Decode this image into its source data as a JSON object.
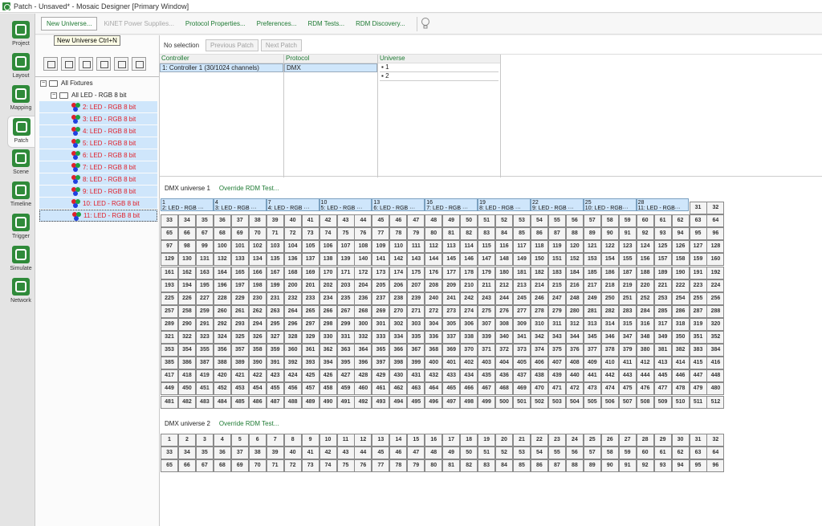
{
  "window": {
    "title": "Patch - Unsaved* - Mosaic Designer [Primary Window]"
  },
  "sidebar": {
    "items": [
      {
        "label": "Project",
        "icon": "project-icon"
      },
      {
        "label": "Layout",
        "icon": "layout-icon"
      },
      {
        "label": "Mapping",
        "icon": "mapping-icon"
      },
      {
        "label": "Patch",
        "icon": "patch-icon"
      },
      {
        "label": "Scene",
        "icon": "scene-icon"
      },
      {
        "label": "Timeline",
        "icon": "timeline-icon"
      },
      {
        "label": "Trigger",
        "icon": "trigger-icon"
      },
      {
        "label": "Simulate",
        "icon": "simulate-icon"
      },
      {
        "label": "Network",
        "icon": "network-icon"
      }
    ],
    "active": "Patch"
  },
  "toolbar": {
    "new_universe": "New Universe...",
    "kinet": "KiNET Power Supplies...",
    "protocol": "Protocol Properties...",
    "preferences": "Preferences...",
    "rdm_tests": "RDM Tests...",
    "rdm_discovery": "RDM Discovery...",
    "tooltip": "New Universe   Ctrl+N"
  },
  "patchbar": {
    "selection": "No selection",
    "prev": "Previous Patch",
    "next": "Next Patch"
  },
  "tree": {
    "root": "All Fixtures",
    "group": "All LED - RGB 8 bit",
    "fixtures": [
      "2: LED - RGB 8 bit",
      "3: LED - RGB 8 bit",
      "4: LED - RGB 8 bit",
      "5: LED - RGB 8 bit",
      "6: LED - RGB 8 bit",
      "7: LED - RGB 8 bit",
      "8: LED - RGB 8 bit",
      "9: LED - RGB 8 bit",
      "10: LED - RGB 8 bit",
      "11: LED - RGB 8 bit"
    ]
  },
  "columns": {
    "controller": {
      "header": "Controller",
      "row": "1: Controller 1 (30/1024 channels)"
    },
    "protocol": {
      "header": "Protocol",
      "row": "DMX"
    },
    "universe": {
      "header": "Universe",
      "rows": [
        "1",
        "2"
      ]
    }
  },
  "universes": [
    {
      "name": "DMX universe 1",
      "override": "Override RDM Test...",
      "fixtures": [
        {
          "start": 1,
          "label": "2: LED - RGB ···"
        },
        {
          "start": 4,
          "label": "3: LED - RGB ···"
        },
        {
          "start": 7,
          "label": "4: LED - RGB ···"
        },
        {
          "start": 10,
          "label": "5: LED - RGB ···"
        },
        {
          "start": 13,
          "label": "6: LED - RGB ···"
        },
        {
          "start": 16,
          "label": "7: LED - RGB ···"
        },
        {
          "start": 19,
          "label": "8: LED - RGB ···"
        },
        {
          "start": 22,
          "label": "9: LED - RGB ···"
        },
        {
          "start": 25,
          "label": "10: LED - RGB···"
        },
        {
          "start": 28,
          "label": "11: LED - RGB···"
        }
      ],
      "channels": 512
    },
    {
      "name": "DMX universe 2",
      "override": "Override RDM Test...",
      "fixtures": [],
      "channels": 96
    }
  ]
}
